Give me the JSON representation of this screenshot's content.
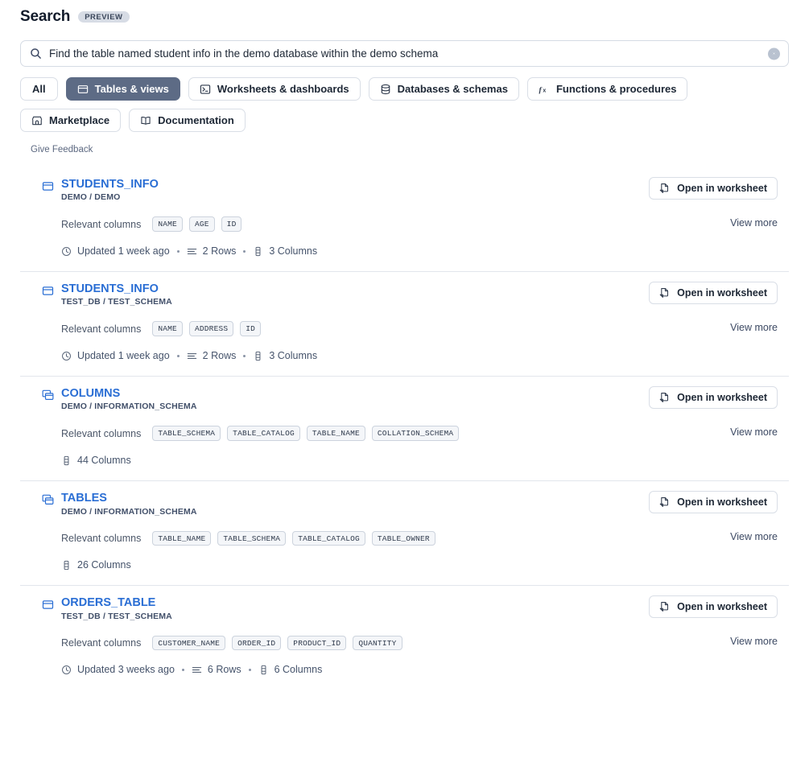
{
  "header": {
    "title": "Search",
    "badge": "PREVIEW"
  },
  "search": {
    "value": "Find the table named student info in the demo database within the demo schema",
    "placeholder": "Search",
    "search_icon": "search-icon",
    "clear_icon": "clear-circle-icon"
  },
  "filters": [
    {
      "label": "All",
      "icon": null,
      "active": false
    },
    {
      "label": "Tables & views",
      "icon": "table-icon",
      "active": true
    },
    {
      "label": "Worksheets & dashboards",
      "icon": "terminal-icon",
      "active": false
    },
    {
      "label": "Databases & schemas",
      "icon": "database-icon",
      "active": false
    },
    {
      "label": "Functions & procedures",
      "icon": "function-icon",
      "active": false
    },
    {
      "label": "Marketplace",
      "icon": "storefront-icon",
      "active": false
    },
    {
      "label": "Documentation",
      "icon": "book-icon",
      "active": false
    }
  ],
  "feedback_label": "Give Feedback",
  "labels": {
    "relevant_columns": "Relevant columns",
    "open_in_worksheet": "Open in worksheet",
    "view_more": "View more"
  },
  "colors": {
    "link": "#2a6ed4",
    "active_chip": "#5d6b85",
    "badge_bg": "#d7dce5",
    "pill_bg": "#f4f6f9",
    "divider": "#e2e6ec"
  },
  "results": [
    {
      "name": "STUDENTS_INFO",
      "path": "DEMO / DEMO",
      "type_icon": "table-icon",
      "columns": [
        "NAME",
        "AGE",
        "ID"
      ],
      "meta": [
        {
          "icon": "clock-icon",
          "text": "Updated 1 week ago"
        },
        {
          "icon": "rows-icon",
          "text": "2 Rows"
        },
        {
          "icon": "columns-icon",
          "text": "3 Columns"
        }
      ]
    },
    {
      "name": "STUDENTS_INFO",
      "path": "TEST_DB / TEST_SCHEMA",
      "type_icon": "table-icon",
      "columns": [
        "NAME",
        "ADDRESS",
        "ID"
      ],
      "meta": [
        {
          "icon": "clock-icon",
          "text": "Updated 1 week ago"
        },
        {
          "icon": "rows-icon",
          "text": "2 Rows"
        },
        {
          "icon": "columns-icon",
          "text": "3 Columns"
        }
      ]
    },
    {
      "name": "COLUMNS",
      "path": "DEMO / INFORMATION_SCHEMA",
      "type_icon": "view-icon",
      "columns": [
        "TABLE_SCHEMA",
        "TABLE_CATALOG",
        "TABLE_NAME",
        "COLLATION_SCHEMA"
      ],
      "meta": [
        {
          "icon": "columns-icon",
          "text": "44 Columns"
        }
      ]
    },
    {
      "name": "TABLES",
      "path": "DEMO / INFORMATION_SCHEMA",
      "type_icon": "view-icon",
      "columns": [
        "TABLE_NAME",
        "TABLE_SCHEMA",
        "TABLE_CATALOG",
        "TABLE_OWNER"
      ],
      "meta": [
        {
          "icon": "columns-icon",
          "text": "26 Columns"
        }
      ]
    },
    {
      "name": "ORDERS_TABLE",
      "path": "TEST_DB / TEST_SCHEMA",
      "type_icon": "table-icon",
      "columns": [
        "CUSTOMER_NAME",
        "ORDER_ID",
        "PRODUCT_ID",
        "QUANTITY"
      ],
      "meta": [
        {
          "icon": "clock-icon",
          "text": "Updated 3 weeks ago"
        },
        {
          "icon": "rows-icon",
          "text": "6 Rows"
        },
        {
          "icon": "columns-icon",
          "text": "6 Columns"
        }
      ]
    }
  ]
}
